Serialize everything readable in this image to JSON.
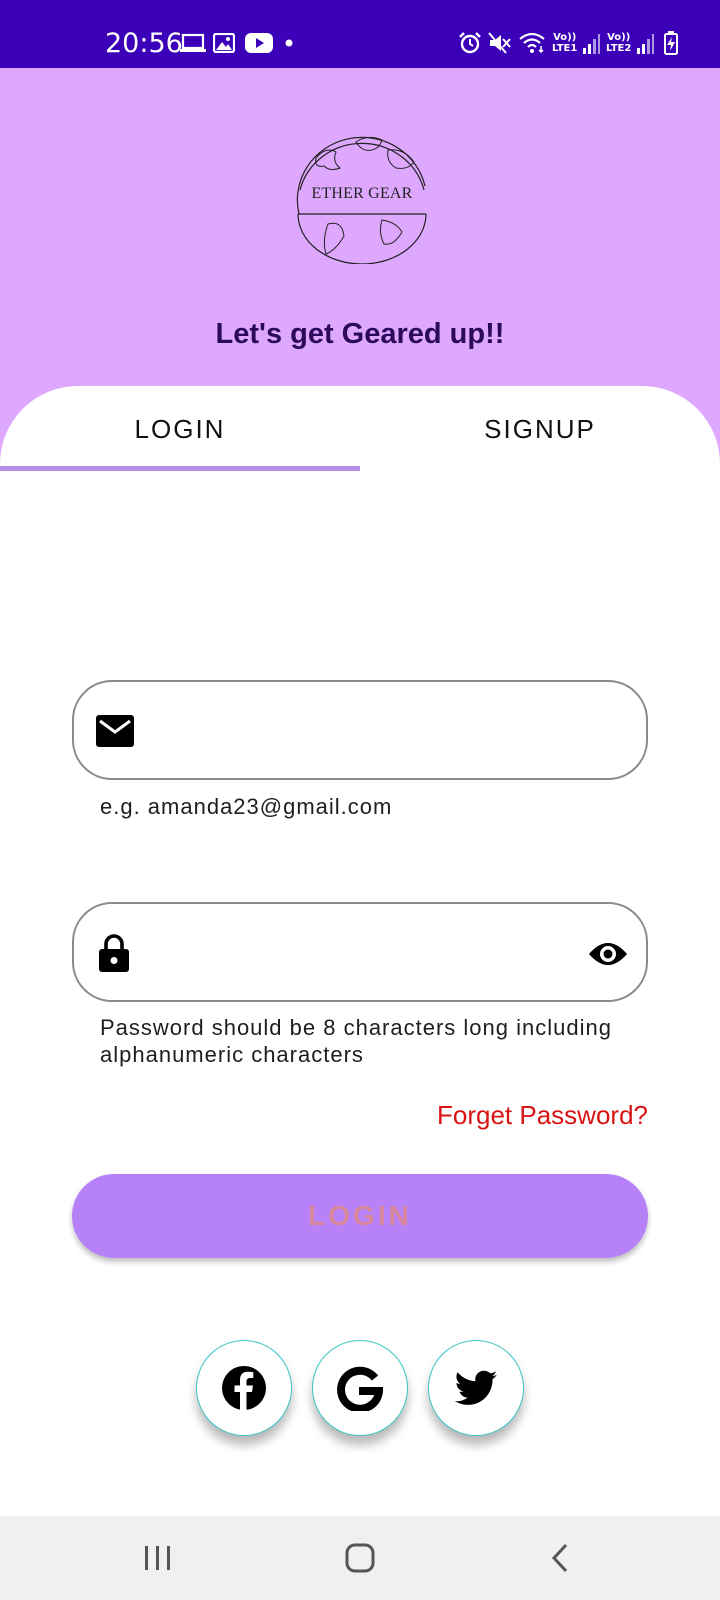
{
  "status_bar": {
    "time": "20:56",
    "notification_icons": [
      "laptop-icon",
      "image-icon",
      "youtube-icon",
      "dot-icon"
    ],
    "system_icons": [
      "alarm-icon",
      "mute-icon",
      "wifi-icon",
      "signal-icon",
      "signal-icon",
      "battery-charging-icon"
    ],
    "sim1_label_top": "Vo))",
    "sim1_label_bottom": "LTE1",
    "sim2_label_top": "Vo))",
    "sim2_label_bottom": "LTE2"
  },
  "header": {
    "logo_text": "ETHER GEAR",
    "tagline": "Let's get Geared up!!"
  },
  "tabs": [
    {
      "label": "LOGIN",
      "selected": true
    },
    {
      "label": "SIGNUP",
      "selected": false
    }
  ],
  "form": {
    "email": {
      "value": "",
      "icon": "mail-icon",
      "helper": "e.g. amanda23@gmail.com"
    },
    "password": {
      "value": "",
      "icon": "lock-icon",
      "toggle_icon": "eye-icon",
      "helper": "Password should be 8 characters long including alphanumeric characters"
    },
    "forget_password": "Forget Password?",
    "login_button": "LOGIN"
  },
  "social": [
    "facebook-icon",
    "google-icon",
    "twitter-icon"
  ],
  "nav_bar": [
    "recent-apps-icon",
    "home-icon",
    "back-icon"
  ],
  "colors": {
    "status_bar": "#3b00b8",
    "header_bg": "#dfa8ff",
    "tab_indicator": "#b98ee8",
    "login_button_bg": "#b782f8",
    "login_button_text": "#d9889c",
    "forget_password": "#d91414",
    "social_border": "#3cc6c6"
  }
}
